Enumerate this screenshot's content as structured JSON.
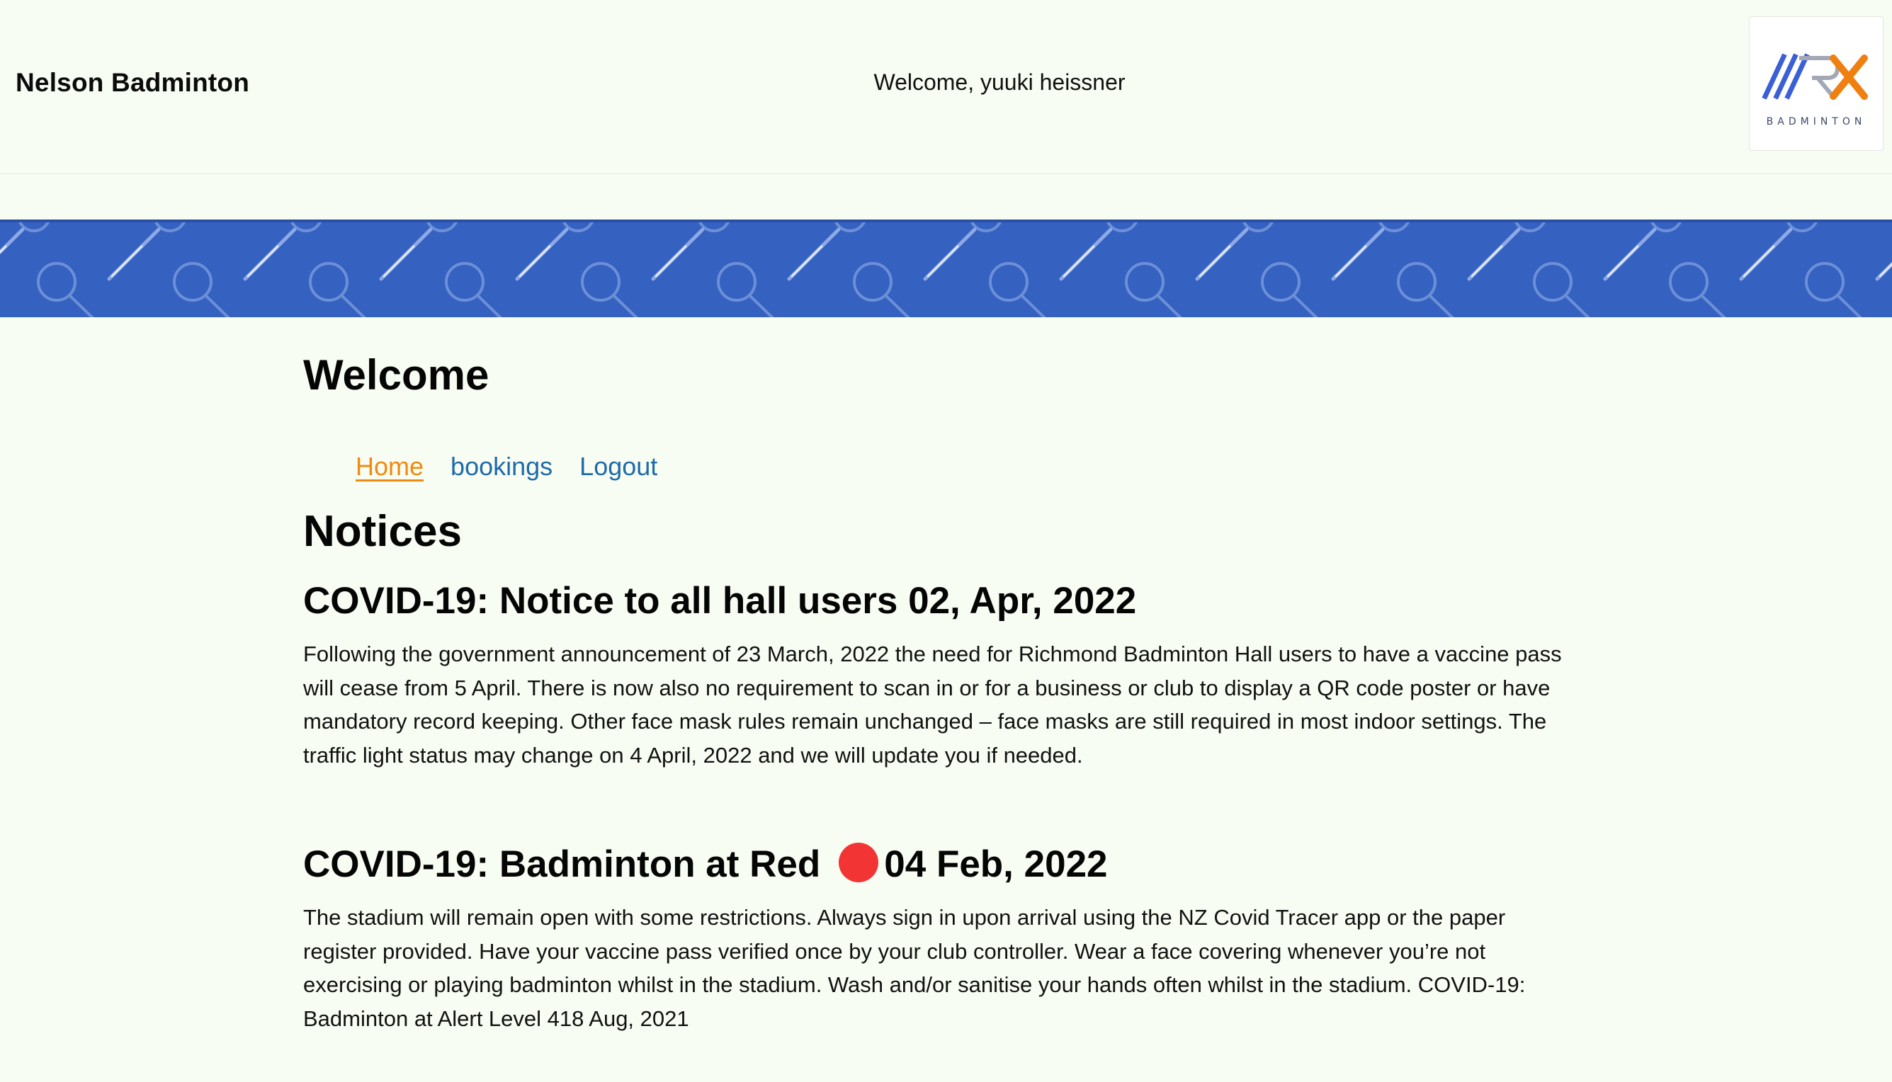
{
  "header": {
    "brand": "Nelson Badminton",
    "welcome_text": "Welcome, yuuki heissner",
    "logo_text": "BADMINTON"
  },
  "colors": {
    "background": "#f7fdf2",
    "banner": "#3562c0",
    "link": "#1f6aa8",
    "active_link": "#f08a10",
    "red_status": "#f23434"
  },
  "icons": {
    "logo": "nrx-badminton-logo",
    "banner": "badminton-racket-pattern",
    "status": "red-circle-icon"
  },
  "main": {
    "title": "Welcome",
    "nav": [
      {
        "label": "Home",
        "active": true
      },
      {
        "label": "bookings",
        "active": false
      },
      {
        "label": "Logout",
        "active": false
      }
    ],
    "notices_title": "Notices",
    "notices": [
      {
        "title": "COVID-19: Notice to all hall users 02, Apr, 2022",
        "lines": [
          "Following the government announcement of 23 March, 2022 the need for Richmond Badminton Hall users to have a vaccine pass",
          "will cease from 5 April. There is now also no requirement to scan in or for a business or club to display a QR code poster or have",
          "mandatory record keeping. Other face mask rules remain unchanged – face masks are still required in most indoor settings. The",
          "traffic light status may change on 4 April, 2022 and we will update you if needed."
        ]
      },
      {
        "title_before": "COVID-19: Badminton at Red",
        "title_after": "04 Feb, 2022",
        "lines": [
          "The stadium will remain open with some restrictions. Always sign in upon arrival using the NZ Covid Tracer app or the paper",
          "register provided. Have your vaccine pass verified once by your club controller. Wear a face covering whenever you’re not",
          "exercising or playing badminton whilst in the stadium. Wash and/or sanitise your hands often whilst in the stadium. COVID-19:",
          "Badminton at Alert Level 418 Aug, 2021"
        ]
      }
    ]
  }
}
